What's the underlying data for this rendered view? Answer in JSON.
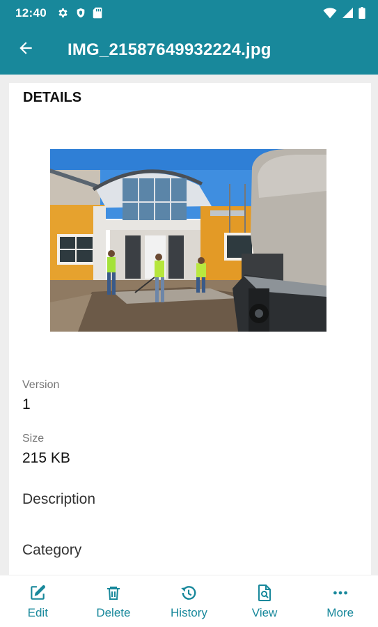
{
  "status_bar": {
    "time": "12:40"
  },
  "toolbar": {
    "title": "IMG_21587649932224.jpg"
  },
  "details": {
    "heading": "DETAILS",
    "fields": [
      {
        "label": "Version",
        "value": "1"
      },
      {
        "label": "Size",
        "value": "215 KB"
      }
    ],
    "description_label": "Description",
    "category_label": "Category"
  },
  "bottom_nav": [
    {
      "label": "Edit",
      "icon": "edit-icon"
    },
    {
      "label": "Delete",
      "icon": "trash-icon"
    },
    {
      "label": "History",
      "icon": "history-icon"
    },
    {
      "label": "View",
      "icon": "view-document-icon"
    },
    {
      "label": "More",
      "icon": "more-horizontal-icon"
    }
  ],
  "colors": {
    "accent": "#18889b",
    "background": "#eeeeee",
    "card": "#ffffff"
  }
}
